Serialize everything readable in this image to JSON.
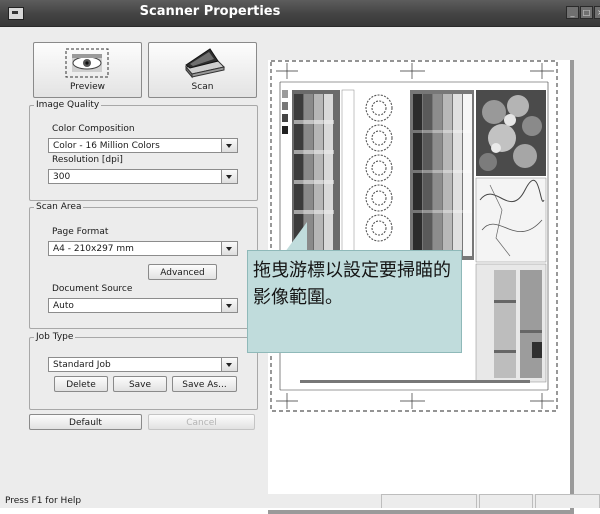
{
  "window": {
    "title": "Scanner Properties",
    "buttons": {
      "minimize": "_",
      "maximize": "□",
      "close": "×"
    }
  },
  "toolbar": {
    "preview_label": "Preview",
    "scan_label": "Scan"
  },
  "image_quality": {
    "legend": "Image Quality",
    "color_label": "Color Composition",
    "color_value": "Color - 16 Million Colors",
    "resolution_label": "Resolution [dpi]",
    "resolution_value": "300"
  },
  "scan_area": {
    "legend": "Scan Area",
    "page_format_label": "Page Format",
    "page_format_value": "A4 - 210x297 mm",
    "advanced_label": "Advanced",
    "source_label": "Document Source",
    "source_value": "Auto"
  },
  "job_type": {
    "legend": "Job Type",
    "value": "Standard Job",
    "delete_label": "Delete",
    "save_label": "Save",
    "save_as_label": "Save As..."
  },
  "footer_buttons": {
    "default_label": "Default",
    "cancel_label": "Cancel"
  },
  "callout": {
    "text": "拖曳游標以設定要掃瞄的影像範圍。"
  },
  "status": {
    "help_text": "Press F1 for Help"
  },
  "colors": {
    "titlebar": "#434343",
    "callout_bg": "#c0dcdc",
    "window_bg": "#ececec"
  }
}
